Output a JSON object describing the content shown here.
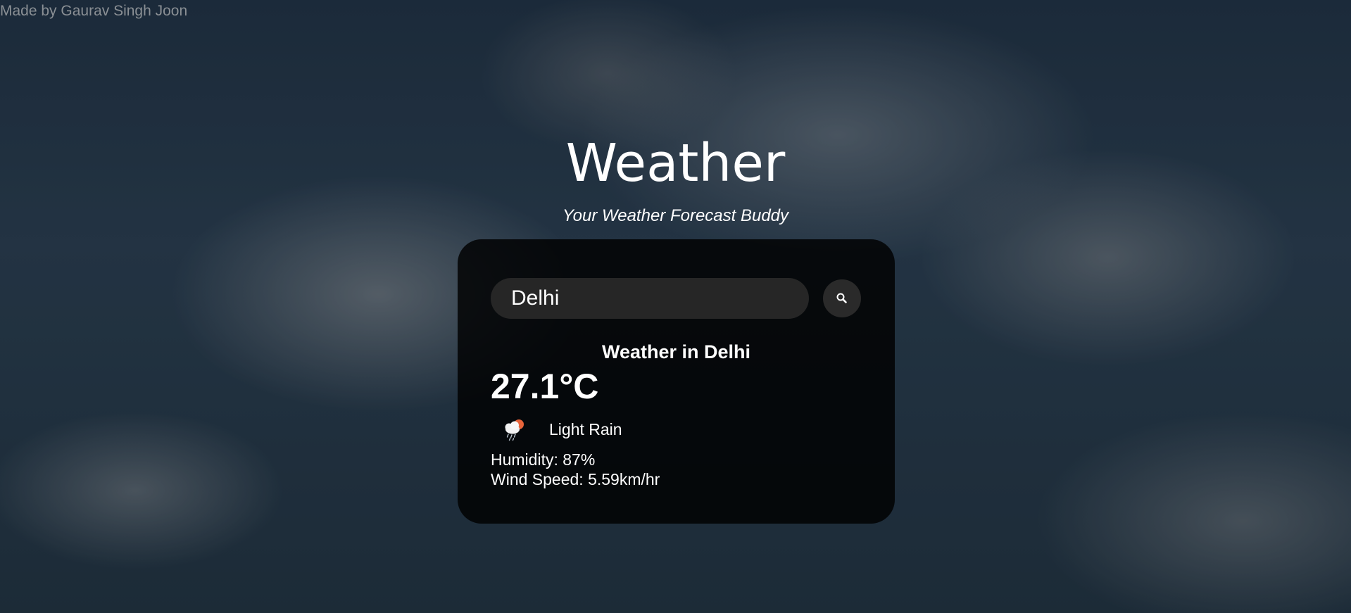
{
  "credit": "Made by Gaurav Singh Joon",
  "header": {
    "title": "Weather",
    "subtitle": "Your Weather Forecast Buddy"
  },
  "search": {
    "value": "Delhi",
    "button_icon": "search-icon"
  },
  "weather": {
    "heading": "Weather in Delhi",
    "temperature": "27.1°C",
    "condition_icon": "rain-cloud-sun-icon",
    "condition": "Light Rain",
    "humidity": "Humidity: 87%",
    "wind": "Wind Speed: 5.59km/hr"
  },
  "colors": {
    "card_background": "#0b0b0b",
    "input_background": "#262626",
    "text": "#ffffff",
    "credit_text": "#8a8f94"
  }
}
